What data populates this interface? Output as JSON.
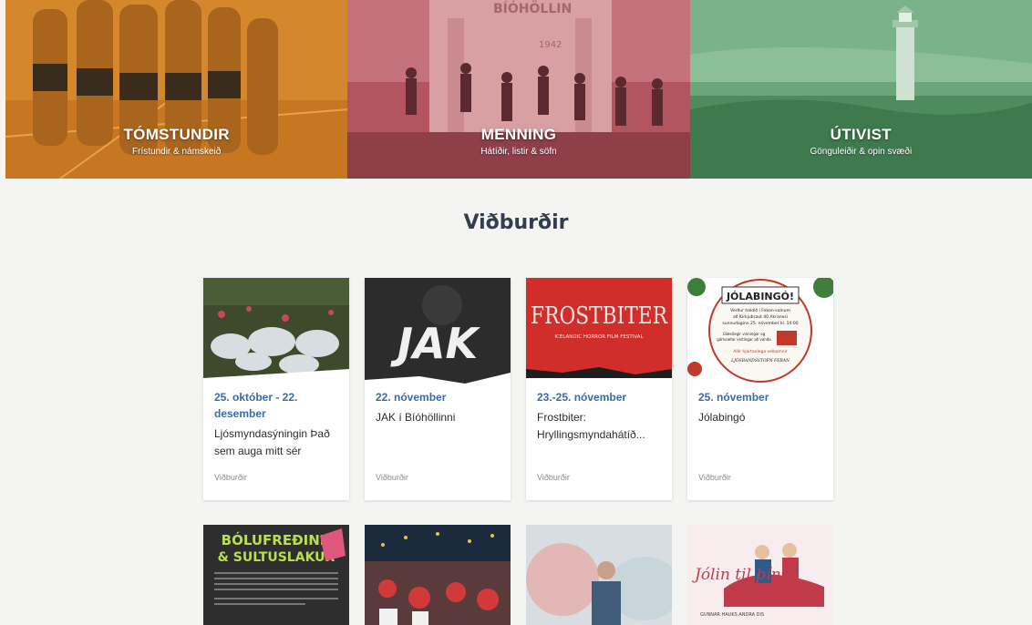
{
  "hero": [
    {
      "title": "TÓMSTUNDIR",
      "subtitle": "Frístundir & námskeið"
    },
    {
      "title": "MENNING",
      "subtitle": "Hátíðir, listir & söfn",
      "sign": "BÍÓHÖLLIN",
      "year": "1942"
    },
    {
      "title": "ÚTIVIST",
      "subtitle": "Gönguleiðir & opin svæði"
    }
  ],
  "events_title": "Viðburðir",
  "events": [
    {
      "date": "25. október - 22. desember",
      "name": "Ljósmyndasýningin Það sem auga mitt sér",
      "category": "Viðburðir"
    },
    {
      "date": "22. nóvember",
      "name": "JAK í Bíóhöllinni",
      "category": "Viðburðir",
      "poster": "JAK"
    },
    {
      "date": "23.-25. nóvember",
      "name": "Frostbiter: Hryllingsmyndahátíð...",
      "category": "Viðburðir",
      "poster": "FROSTBITER",
      "poster_sub": "ICELANDIC HORROR FILM FESTIVAL"
    },
    {
      "date": "25. nóvember",
      "name": "Jólabingó",
      "category": "Viðburðir",
      "poster": "JÓLABINGÓ!",
      "poster_lines": [
        "Verður haldið í Feban-salnum",
        "að Kirkjubraut 40 Akranesi",
        "sunnudaginn 25. nóvember kl. 14:00",
        "Glæsilegir vinningar og",
        "gómsætar veitingar að vanda",
        "Allir hjartanlega velkomnir",
        "LJÓSBANDSSTOFN FEBAN"
      ]
    }
  ],
  "events_row2": [
    {
      "poster_line1": "BÓLUFREÐINN",
      "poster_line2": "& SULTUSLAKUR"
    },
    {},
    {},
    {
      "poster": "Jólin til þín",
      "poster_names": "GUNNAR HAUKS    ANDRA DIS"
    }
  ],
  "colors": {
    "date": "#3b6aa8",
    "title": "#333d4f"
  }
}
